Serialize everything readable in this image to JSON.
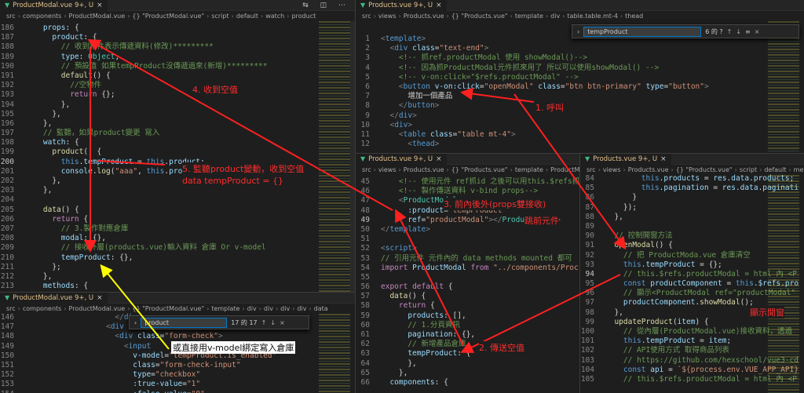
{
  "tab_label": "ProductModal.vue 9+, U",
  "tab_label_products": "Products.vue 9+, U",
  "panes": {
    "tl": {
      "tab": "ProductModal.vue 9+, U",
      "crumbs": [
        "src",
        "components",
        "ProductModal.vue",
        "{} \"ProductModal.vue\"",
        "script",
        "default",
        "watch",
        "product"
      ],
      "lines": [
        {
          "n": "186",
          "h": "    <span class=\"p\">props</span>: {"
        },
        {
          "n": "187",
          "h": "      <span class=\"p\">product</span>: {"
        },
        {
          "n": "188",
          "h": "        <span class=\"c\">// 收到物件表示傳遞資料(修改)*********</span>"
        },
        {
          "n": "189",
          "h": "        <span class=\"p\">type</span>: <span class=\"t\">Object</span>,"
        },
        {
          "n": "190",
          "h": "        <span class=\"c\">// 預設值 如果tempProduct沒傳遞過來(新增)*********</span>"
        },
        {
          "n": "191",
          "h": "        <span class=\"f\">default</span>() {"
        },
        {
          "n": "192",
          "h": "          <span class=\"c\">//空物件</span>"
        },
        {
          "n": "193",
          "h": "          <span class=\"k2\">return</span> {};"
        },
        {
          "n": "194",
          "h": "        },"
        },
        {
          "n": "195",
          "h": "      },"
        },
        {
          "n": "196",
          "h": "    },"
        },
        {
          "n": "197",
          "h": "    <span class=\"c\">// 監聽，如果product變更 寫入</span>"
        },
        {
          "n": "198",
          "h": "    <span class=\"p\">watch</span>: {"
        },
        {
          "n": "199",
          "h": "      <span class=\"f\">product</span>() {"
        },
        {
          "n": "200",
          "h": "        <span class=\"k\">this</span>.<span class=\"p\">tempProduct</span> = <span class=\"k\">this</span>.<span class=\"p\">product</span>;"
        },
        {
          "n": "201",
          "h": "        <span class=\"p\">console</span>.<span class=\"f\">log</span>(<span class=\"s\">\"aaa\"</span>, <span class=\"k\">this</span>.<span class=\"p\">product</span>)"
        },
        {
          "n": "202",
          "h": "      },"
        },
        {
          "n": "203",
          "h": "    },"
        },
        {
          "n": "204",
          "h": ""
        },
        {
          "n": "205",
          "h": "    <span class=\"f\">data</span>() {"
        },
        {
          "n": "206",
          "h": "      <span class=\"k2\">return</span> {"
        },
        {
          "n": "207",
          "h": "        <span class=\"c\">// 3.製作對應倉庫</span>"
        },
        {
          "n": "208",
          "h": "        <span class=\"p\">modal</span>: {},"
        },
        {
          "n": "209",
          "h": "        <span class=\"c\">// 接收外層(products.vue)輸入資料 倉庫 Or v-model</span>"
        },
        {
          "n": "210",
          "h": "        <span class=\"p\">tempProduct</span>: {},"
        },
        {
          "n": "211",
          "h": "      };"
        },
        {
          "n": "212",
          "h": "    },"
        },
        {
          "n": "213",
          "h": "    <span class=\"p\">methods</span>: {"
        }
      ]
    },
    "bl": {
      "tab": "ProductModal.vue 9+, U",
      "crumbs": [
        "src",
        "components",
        "ProductModal.vue",
        "{} \"ProductModal.vue\"",
        "template",
        "div",
        "div",
        "div",
        "div",
        "data"
      ],
      "lines": [
        {
          "n": "146",
          "h": "                    <span class=\"g\">&lt;/</span><span class=\"tag\">div</span><span class=\"g\">&gt;</span>"
        },
        {
          "n": "147",
          "h": "                  <span class=\"g\">&lt;</span><span class=\"tag\">div</span> <span class=\"at\">clas</span>"
        },
        {
          "n": "148",
          "h": "                    <span class=\"g\">&lt;</span><span class=\"tag\">div</span> <span class=\"at\">class</span>=<span class=\"s\">\"form-check\"</span><span class=\"g\">&gt;</span>"
        },
        {
          "n": "149",
          "h": "                      <span class=\"g\">&lt;</span><span class=\"tag\">input</span>"
        },
        {
          "n": "150",
          "h": "                        <span class=\"at\">v-model</span>=<span class=\"s\">\"tempProduct.is_enabled\"</span>"
        },
        {
          "n": "151",
          "h": "                        <span class=\"at\">class</span>=<span class=\"s\">\"form-check-input\"</span>"
        },
        {
          "n": "152",
          "h": "                        <span class=\"at\">type</span>=<span class=\"s\">\"checkbox\"</span>"
        },
        {
          "n": "153",
          "h": "                        <span class=\"at\">:true-value</span>=<span class=\"s\">\"1\"</span>"
        },
        {
          "n": "154",
          "h": "                        <span class=\"at\">:false-value</span>=<span class=\"s\">\"0\"</span>"
        }
      ]
    },
    "tr": {
      "tab": "Products.vue 9+, U",
      "crumbs": [
        "src",
        "views",
        "Products.vue",
        "{} \"Products.vue\"",
        "template",
        "div",
        "table.table.mt-4",
        "thead"
      ],
      "lines": [
        {
          "n": "1",
          "h": "<span class=\"g\">&lt;</span><span class=\"tag\">template</span><span class=\"g\">&gt;</span>"
        },
        {
          "n": "2",
          "h": "  <span class=\"g\">&lt;</span><span class=\"tag\">div</span> <span class=\"at\">class</span>=<span class=\"s\">\"text-end\"</span><span class=\"g\">&gt;</span>"
        },
        {
          "n": "3",
          "h": "    <span class=\"c\">&lt;!-- 抓ref.productModal 使用 showModal()--&gt;</span>"
        },
        {
          "n": "4",
          "h": "    <span class=\"c\">&lt;!-- 因為抓ProductModal元件抓來用了 所以可以使用showModal() --&gt;</span>"
        },
        {
          "n": "5",
          "h": "    <span class=\"c\">&lt;!-- v-on:click=\"$refs.productModal\" --&gt;</span>"
        },
        {
          "n": "6",
          "h": "    <span class=\"g\">&lt;</span><span class=\"tag\">button</span> <span class=\"at\">v-on:click</span>=<span class=\"s\">\"openModal\"</span> <span class=\"at\">class</span>=<span class=\"s\">\"btn btn-primary\"</span> <span class=\"at\">type</span>=<span class=\"s\">\"button\"</span><span class=\"g\">&gt;</span>"
        },
        {
          "n": "7",
          "h": "      <span class=\"txt\">增加一個產品</span>"
        },
        {
          "n": "8",
          "h": "    <span class=\"g\">&lt;/</span><span class=\"tag\">button</span><span class=\"g\">&gt;</span>"
        },
        {
          "n": "9",
          "h": "  <span class=\"g\">&lt;/</span><span class=\"tag\">div</span><span class=\"g\">&gt;</span>"
        },
        {
          "n": "10",
          "h": "  <span class=\"g\">&lt;</span><span class=\"tag\">div</span><span class=\"g\">&gt;</span>"
        },
        {
          "n": "11",
          "h": "    <span class=\"g\">&lt;</span><span class=\"tag\">table</span> <span class=\"at\">class</span>=<span class=\"s\">\"table mt-4\"</span><span class=\"g\">&gt;</span>"
        },
        {
          "n": "12",
          "h": "      <span class=\"g\">&lt;</span><span class=\"tag\">thead</span><span class=\"g\">&gt;</span>"
        }
      ]
    },
    "mr": {
      "tab": "Products.vue 9+, U",
      "crumbs": [
        "src",
        "views",
        "Products.vue",
        "{} \"Products.vue\"",
        "template",
        "ProductModal"
      ],
      "lines": [
        {
          "n": "45",
          "h": "    <span class=\"c\">&lt;!-- 使用元件 ref抓id 之後可以用this.$refs抓</span>"
        },
        {
          "n": "46",
          "h": "    <span class=\"c\">&lt;!-- 製作傳送資料 v-bind props--&gt;</span>"
        },
        {
          "n": "47",
          "h": "    <span class=\"g\">&lt;</span><span class=\"t\">ProductModal</span>"
        },
        {
          "n": "48",
          "h": "      <span class=\"at\">:product</span>=<span class=\"s\">\"tempProduct\"</span>"
        },
        {
          "n": "49",
          "h": "      <span class=\"at\">ref</span>=<span class=\"s\">\"productModal\"</span><span class=\"g\">&gt;&lt;/</span><span class=\"t\">ProductModal</span><span class=\"g\">&gt;</span>"
        },
        {
          "n": "50",
          "h": "<span class=\"g\">&lt;/</span><span class=\"tag\">template</span><span class=\"g\">&gt;</span>"
        },
        {
          "n": "51",
          "h": ""
        },
        {
          "n": "52",
          "h": "<span class=\"g\">&lt;</span><span class=\"tag\">script</span><span class=\"g\">&gt;</span>"
        },
        {
          "n": "53",
          "h": "<span class=\"c\">// 引用元件 元件內的 data methods mounted 都可</span>"
        },
        {
          "n": "54",
          "h": "<span class=\"k2\">import</span> <span class=\"p\">ProductModal</span> <span class=\"k2\">from</span> <span class=\"s\">\"../components/Proc</span>"
        },
        {
          "n": "55",
          "h": ""
        },
        {
          "n": "56",
          "h": "<span class=\"k2\">export</span> <span class=\"k2\">default</span> {"
        },
        {
          "n": "57",
          "h": "  <span class=\"f\">data</span>() {"
        },
        {
          "n": "58",
          "h": "    <span class=\"k2\">return</span> {"
        },
        {
          "n": "59",
          "h": "      <span class=\"p\">products</span>: [],"
        },
        {
          "n": "60",
          "h": "      <span class=\"c\">// 1.分頁資訊</span>"
        },
        {
          "n": "61",
          "h": "      <span class=\"p\">pagination</span>: {},"
        },
        {
          "n": "62",
          "h": "      <span class=\"c\">// 新增產品倉庫</span>"
        },
        {
          "n": "63",
          "h": "      <span class=\"p\">tempProduct</span>: {"
        },
        {
          "n": "64",
          "h": "      },"
        },
        {
          "n": "65",
          "h": "    },"
        },
        {
          "n": "66",
          "h": "  <span class=\"p\">components</span>: {"
        }
      ]
    },
    "br": {
      "tab": "Products.vue 9+, U",
      "crumbs": [
        "src",
        "views",
        "Products.vue",
        "{} \"Products.vue\"",
        "script",
        "default",
        "methods"
      ],
      "lines": [
        {
          "n": "84",
          "h": "        <span class=\"k\">this</span>.<span class=\"p\">products</span> = <span class=\"p\">res</span>.<span class=\"p\">data</span>.<span class=\"p\">products</span>;"
        },
        {
          "n": "85",
          "h": "        <span class=\"k\">this</span>.<span class=\"p\">pagination</span> = <span class=\"p\">res</span>.<span class=\"p\">data</span>.<span class=\"p\">paginati</span>"
        },
        {
          "n": "86",
          "h": "      }"
        },
        {
          "n": "87",
          "h": "    });"
        },
        {
          "n": "88",
          "h": "  },"
        },
        {
          "n": "89",
          "h": ""
        },
        {
          "n": "90",
          "h": "  <span class=\"c\">// 控制開窗方法</span>"
        },
        {
          "n": "91",
          "h": "  <span class=\"f\">openModal</span>() {"
        },
        {
          "n": "92",
          "h": "    <span class=\"c\">// 把 ProductModa.vue 倉庫清空</span>"
        },
        {
          "n": "93",
          "h": "    <span class=\"k\">this</span>.<span class=\"p\">tempProduct</span> = {};"
        },
        {
          "n": "94",
          "h": "    <span class=\"c\">// this.$refs.productModal = html 內 &lt;P</span>"
        },
        {
          "n": "95",
          "h": "    <span class=\"k\">const</span> <span class=\"p\">productComponent</span> = <span class=\"k\">this</span>.<span class=\"p\">$refs</span>.<span class=\"p\">pro</span>"
        },
        {
          "n": "96",
          "h": "    <span class=\"c\">// 顯示&lt;ProductModal ref=\"productModal\"</span>"
        },
        {
          "n": "97",
          "h": "    <span class=\"p\">productComponent</span>.<span class=\"f\">showModal</span>();"
        },
        {
          "n": "98",
          "h": "  },"
        },
        {
          "n": "99",
          "h": "  <span class=\"f\">updateProduct</span>(<span class=\"p\">item</span>) {"
        },
        {
          "n": "100",
          "h": "    <span class=\"c\">// 從內層(ProductModal.vue)接收資料，透過</span>"
        },
        {
          "n": "101",
          "h": "    <span class=\"k\">this</span>.<span class=\"p\">tempProduct</span> = <span class=\"p\">item</span>;"
        },
        {
          "n": "102",
          "h": "    <span class=\"c\">// API使用方式 取得商品列表</span>"
        },
        {
          "n": "103",
          "h": "    <span class=\"c\">// https://github.com/hexschool/vue3-cd</span>"
        },
        {
          "n": "104",
          "h": "    <span class=\"k\">const</span> <span class=\"p\">api</span> = <span class=\"s\">`${process.env.VUE_APP_API}</span>"
        },
        {
          "n": "105",
          "h": "    <span class=\"c\">// this.$refs.productModal = html 內 &lt;P</span>"
        }
      ]
    }
  },
  "find_widgets": {
    "tr": {
      "query": "tempProduct",
      "count": "6 的 ?"
    },
    "bl": {
      "query": "product",
      "count": "17 的 17"
    }
  },
  "annotations": {
    "a1": "1. 呼叫",
    "a2": "2. 傳送空值",
    "a3": "3. 前內後外(props雙接收)",
    "a3b": "跳前元件",
    "a4": "4. 收到空值",
    "a5": "5. 監聽product變動，收到空值",
    "a5b": "data tempProduct = {}",
    "a6": "或直接用v-model綁定寫入倉庫",
    "a7": "顯示開窗"
  },
  "colors": {
    "arrow_red": "#ff2020",
    "arrow_yellow": "#ffff00",
    "tab_modified": "#e2c08d"
  }
}
